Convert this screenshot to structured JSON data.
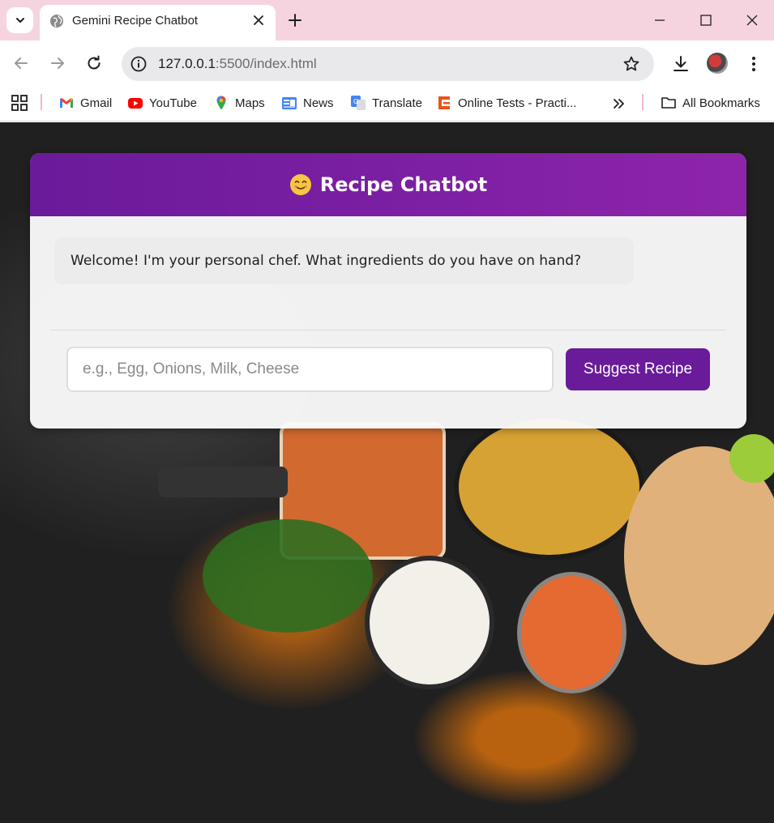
{
  "browser": {
    "tab": {
      "title": "Gemini Recipe Chatbot",
      "favicon": "globe-icon"
    },
    "url": {
      "host": "127.0.0.1",
      "rest": ":5500/index.html"
    },
    "bookmarks": [
      {
        "label": "Gmail",
        "icon": "gmail-icon"
      },
      {
        "label": "YouTube",
        "icon": "youtube-icon"
      },
      {
        "label": "Maps",
        "icon": "maps-icon"
      },
      {
        "label": "News",
        "icon": "news-icon"
      },
      {
        "label": "Translate",
        "icon": "translate-icon"
      },
      {
        "label": "Online Tests - Practi...",
        "icon": "online-tests-icon"
      }
    ],
    "all_bookmarks_label": "All Bookmarks",
    "tabstrip_color": "#f5d4e0"
  },
  "chat": {
    "title": "Recipe Chatbot",
    "emoji": "smiling-face-icon",
    "messages": [
      {
        "sender": "bot",
        "text": "Welcome! I'm your personal chef. What ingredients do you have on hand?"
      }
    ],
    "input_placeholder": "e.g., Egg, Onions, Milk, Cheese",
    "input_value": "",
    "submit_label": "Suggest Recipe",
    "accent_color": "#6a1b9a"
  }
}
